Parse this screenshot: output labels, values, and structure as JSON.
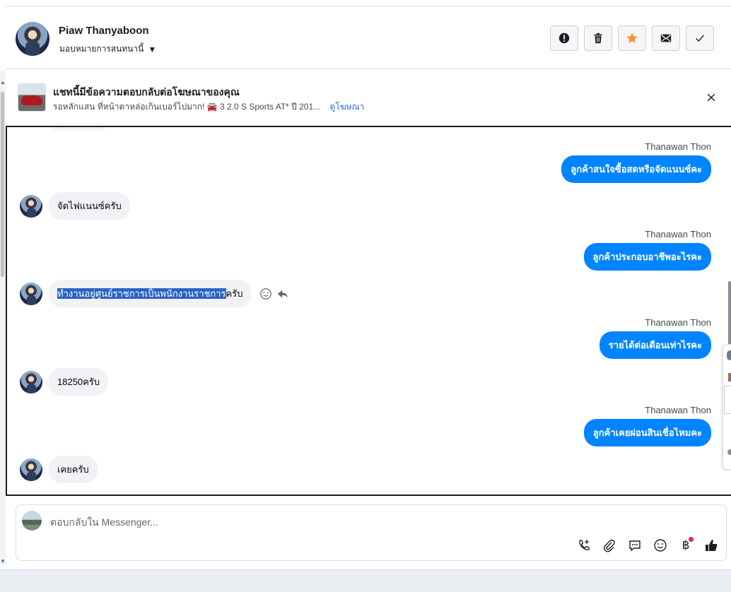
{
  "header": {
    "contact_name": "Piaw Thanyaboon",
    "assign_label": "มอบหมายการสนทนานี้",
    "actions": [
      {
        "icon": "alert-icon",
        "name": "spam-button"
      },
      {
        "icon": "trash-icon",
        "name": "delete-button"
      },
      {
        "icon": "star-icon",
        "name": "star-button"
      },
      {
        "icon": "mail-icon",
        "name": "mark-unread-button"
      },
      {
        "icon": "check-icon",
        "name": "done-button"
      }
    ],
    "star_color": "#f7923b"
  },
  "ad": {
    "title": "แชทนี้มีข้อความตอบกลับต่อโฆษณาของคุณ",
    "subtitle": "รอหลักแสน ที่หน้าตาหล่อเกินเบอร์ไปมาก! 🚘 3 2.0 S Sports AT* ปี 201...",
    "link": "ดูโฆษณา"
  },
  "messages": [
    {
      "dir": "out",
      "sender": "Thanawan Thon",
      "text": "ลูกค้าสนใจซื้อสดหรือจัดแนนซ์คะ"
    },
    {
      "dir": "in",
      "text": "จัดไฟแนนซ์ครับ"
    },
    {
      "dir": "out",
      "sender": "Thanawan Thon",
      "text": "ลูกค้าประกอบอาชีพอะไรคะ"
    },
    {
      "dir": "in",
      "text_selected": "ทำงานอยู่ศูนย์ราชการเป็นพนักงานราชการ",
      "text_rest": "ครับ"
    },
    {
      "dir": "out",
      "sender": "Thanawan Thon",
      "text": "รายได้ต่อเดือนเท่าไรคะ"
    },
    {
      "dir": "in",
      "text": "18250ครับ"
    },
    {
      "dir": "out",
      "sender": "Thanawan Thon",
      "text": "ลูกค้าเคยผ่อนสินเชื่อไหมคะ"
    },
    {
      "dir": "in",
      "text": "เคยครับ"
    }
  ],
  "composer": {
    "placeholder": "ตอบกลับใน Messenger..."
  },
  "colors": {
    "outgoing_bubble": "#0084ff",
    "incoming_bubble": "#f0f2f5",
    "selection": "#2b62c4",
    "link": "#216fdb"
  }
}
